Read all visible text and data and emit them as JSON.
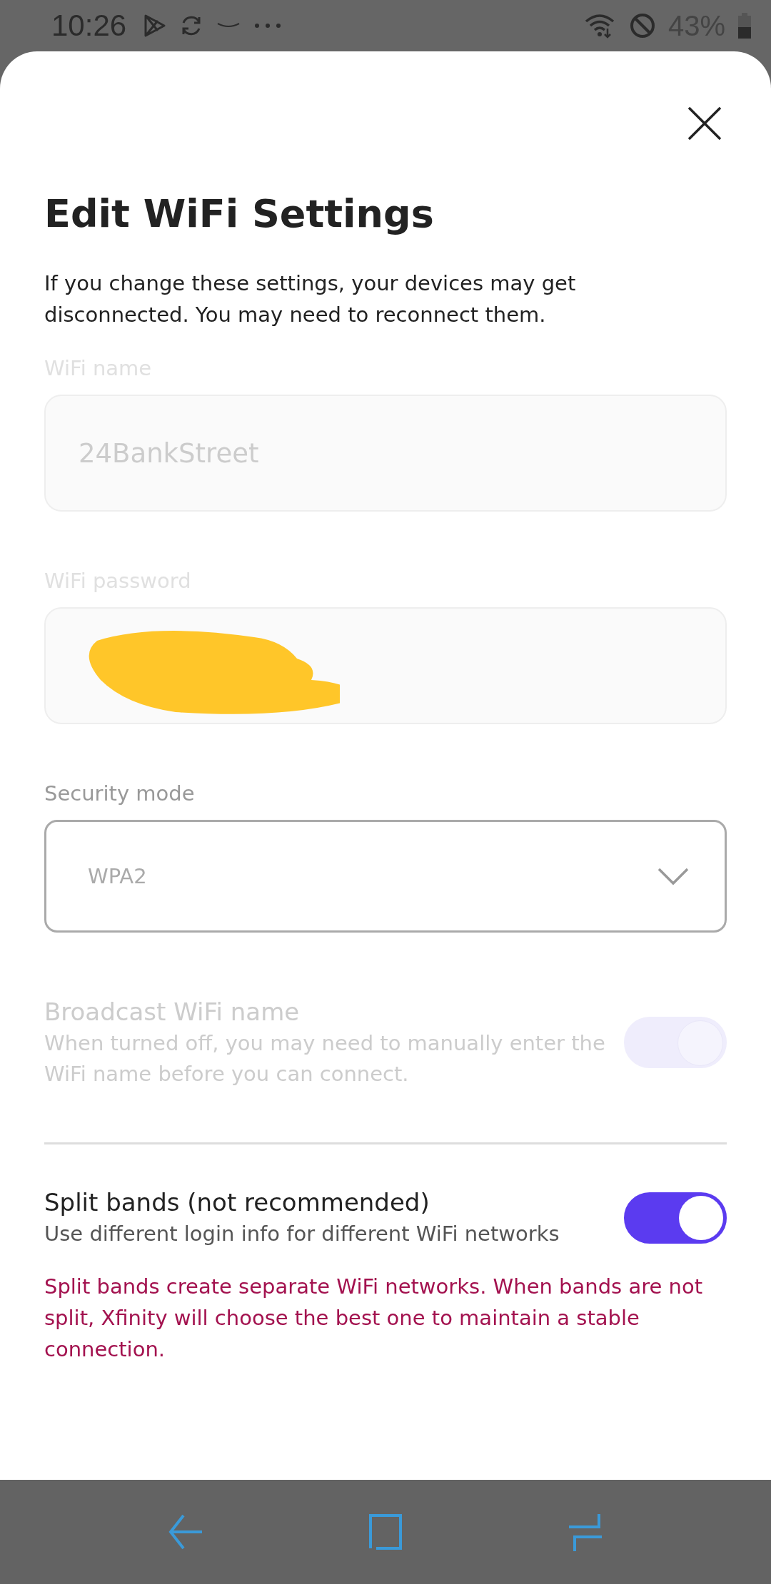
{
  "status_bar": {
    "time": "10:26",
    "battery": "43%"
  },
  "dialog": {
    "title": "Edit WiFi Settings",
    "description": "If you change these settings, your devices may get disconnected. You may need to reconnect them.",
    "fields": [
      {
        "kind": "text",
        "label": "WiFi name",
        "value": "24BankStreet",
        "disabled": true
      },
      {
        "kind": "redacted",
        "label": "WiFi password",
        "disabled": true
      },
      {
        "kind": "select",
        "label": "Security mode",
        "value": "WPA2",
        "disabled": false
      }
    ],
    "toggles": [
      {
        "title": "Broadcast WiFi name",
        "description": "When turned off, you may need to manually enter the WiFi name before you can connect.",
        "on": true,
        "disabled": true
      },
      {
        "title": "Split bands (not recommended)",
        "description": "Use different login info for different WiFi networks",
        "on": true,
        "disabled": false,
        "warning": "Split bands create separate WiFi networks. When bands are not split, Xfinity will choose the best one to maintain a stable connection."
      }
    ]
  }
}
